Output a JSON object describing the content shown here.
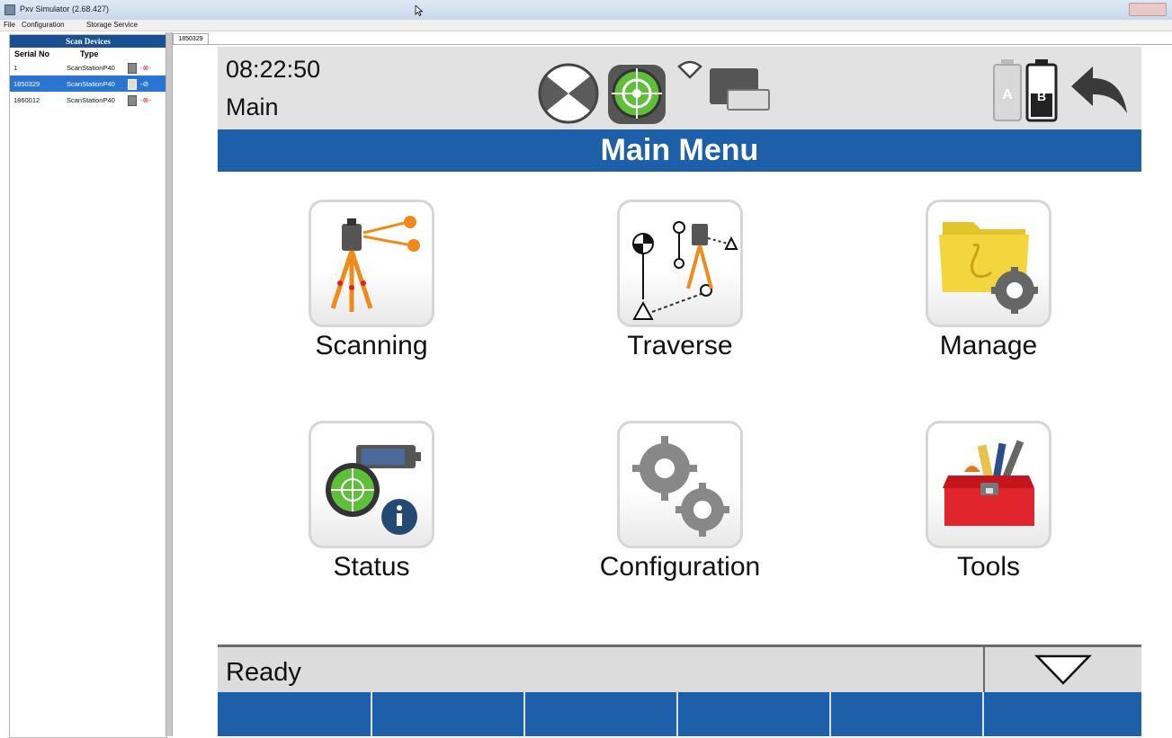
{
  "window": {
    "title": "Pxv Simulator (2.68.427)"
  },
  "menubar": {
    "items": [
      "File",
      "Configuration",
      "Storage Service"
    ]
  },
  "devices_panel": {
    "title": "Scan Devices",
    "columns": [
      "Serial No",
      "Type"
    ],
    "rows": [
      {
        "serial": "1",
        "type": "ScanStationP40"
      },
      {
        "serial": "1850329",
        "type": "ScanStationP40",
        "selected": true
      },
      {
        "serial": "1860012",
        "type": "ScanStationP40"
      }
    ]
  },
  "doc_tab": {
    "label": "1850329"
  },
  "device": {
    "time": "08:22:50",
    "screen": "Main",
    "title": "Main Menu",
    "menu": [
      "Scanning",
      "Traverse",
      "Manage",
      "Status",
      "Configuration",
      "Tools"
    ],
    "battery_labels": [
      "A",
      "B"
    ],
    "status": "Ready"
  },
  "colors": {
    "brand_blue": "#1d5fa9",
    "selected_row": "#2a75cf"
  }
}
